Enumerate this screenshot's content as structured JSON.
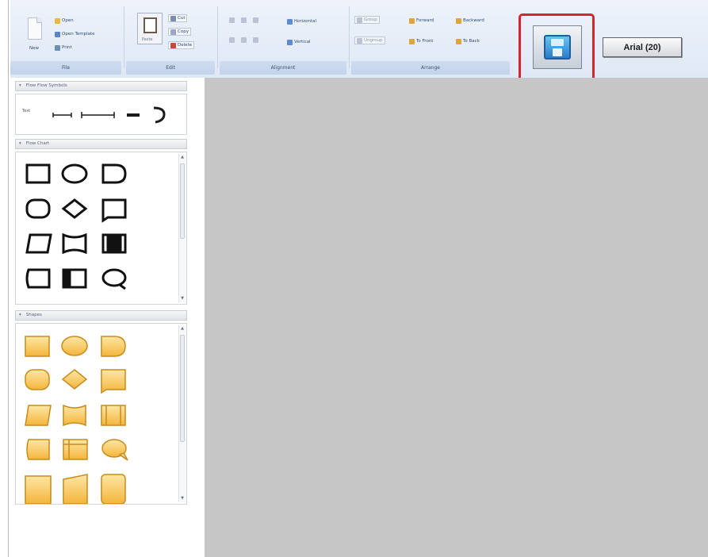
{
  "ribbon": {
    "file": {
      "label": "File",
      "new_label": "New",
      "open_label": "Open",
      "open_template_label": "Open Template",
      "print_label": "Print"
    },
    "edit": {
      "label": "Edit",
      "paste_label": "Paste",
      "cut_label": "Cut",
      "copy_label": "Copy",
      "delete_label": "Delete"
    },
    "alignment": {
      "label": "Alignment",
      "horizontal_label": "Horizontal",
      "vertical_label": "Vertical"
    },
    "arrange": {
      "label": "Arrange",
      "group_label": "Group",
      "ungroup_label": "Ungroup",
      "forward_label": "Forward",
      "backward_label": "Backward",
      "to_front_label": "To Front",
      "to_back_label": "To Back"
    },
    "font_button": {
      "label": "Arial (20)"
    }
  },
  "panels": {
    "flow_symbols": {
      "title": "Flow Flow Symbols",
      "text_sample": "Text"
    },
    "flow_chart": {
      "title": "Flow Chart"
    },
    "shapes": {
      "title": "Shapes"
    }
  },
  "colors": {
    "highlight": "#d6252f",
    "canvas": "#c6c6c6",
    "shape_fill_top": "#fde7a5",
    "shape_fill_bottom": "#f4b53c",
    "shape_stroke": "#c98c1b"
  }
}
